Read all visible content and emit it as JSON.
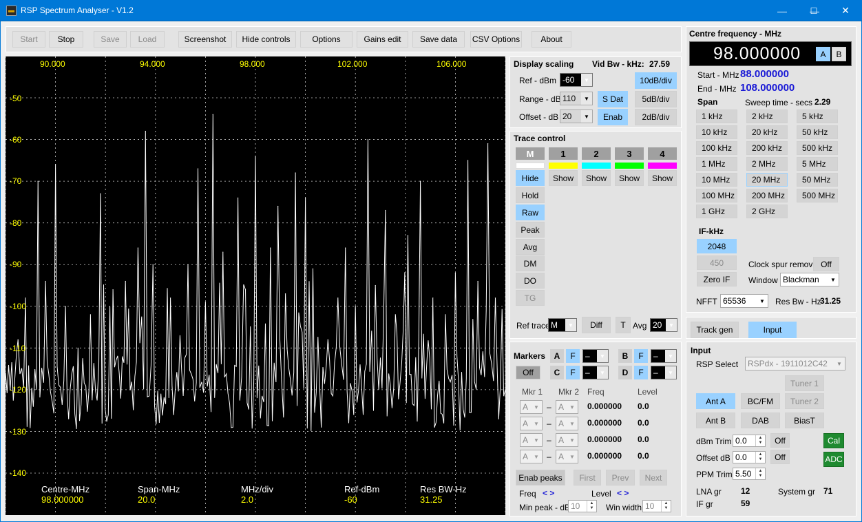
{
  "window": {
    "title": "RSP Spectrum Analyser - V1.2",
    "min": "—",
    "max": "☐",
    "close": "✕"
  },
  "toolbar": {
    "start": "Start",
    "stop": "Stop",
    "save": "Save",
    "load": "Load",
    "screenshot": "Screenshot",
    "hide_controls": "Hide controls",
    "options": "Options",
    "gains_edit": "Gains edit",
    "save_data": "Save data",
    "csv_options": "CSV Options",
    "about": "About"
  },
  "plot": {
    "x_ticks": [
      "90.000",
      "94.000",
      "98.000",
      "102.000",
      "106.000"
    ],
    "y_ticks": [
      "-50",
      "-60",
      "-70",
      "-80",
      "-90",
      "-100",
      "-110",
      "-120",
      "-130",
      "-140"
    ],
    "footer": {
      "centre_label": "Centre-MHz",
      "centre_value": "98.000000",
      "span_label": "Span-MHz",
      "span_value": "20.0",
      "mhzdiv_label": "MHz/div",
      "mhzdiv_value": "2.0",
      "ref_label": "Ref-dBm",
      "ref_value": "-60",
      "resbw_label": "Res BW-Hz",
      "resbw_value": "31.25"
    },
    "colors": {
      "bg": "#000000",
      "tick": "#ffff00",
      "trace": "#ffffff",
      "grid": "#cccccc"
    }
  },
  "chart_data": {
    "type": "line",
    "xlabel": "",
    "ylabel": "",
    "xlim": [
      88,
      108
    ],
    "ylim": [
      -145,
      -45
    ],
    "x_ticks": [
      90,
      94,
      98,
      102,
      106
    ],
    "y_ticks": [
      -50,
      -60,
      -70,
      -80,
      -90,
      -100,
      -110,
      -120,
      -130,
      -140
    ],
    "grid": true,
    "series": [
      {
        "values_note": "",
        "x": [
          88.0,
          88.5,
          88.8,
          89.3,
          89.6,
          90.0,
          90.4,
          90.9,
          91.4,
          91.8,
          92.3,
          92.8,
          93.3,
          93.6,
          93.9,
          94.6,
          95.3,
          95.7,
          96.0,
          96.3,
          96.7,
          97.3,
          97.6,
          98.0,
          98.6,
          98.9,
          99.2,
          99.6,
          100.0,
          100.3,
          100.9,
          101.3,
          101.6,
          102.0,
          102.5,
          102.8,
          103.2,
          103.6,
          104.1,
          104.6,
          105.1,
          105.6,
          106.0,
          106.5,
          106.9,
          107.3,
          107.6,
          108.0
        ],
        "y": [
          -116,
          -108,
          -98,
          -70,
          -94,
          -66,
          -100,
          -110,
          -102,
          -73,
          -96,
          -94,
          -86,
          -58,
          -90,
          -98,
          -90,
          -67,
          -99,
          -54,
          -87,
          -74,
          -96,
          -64,
          -86,
          -76,
          -97,
          -68,
          -74,
          -91,
          -108,
          -98,
          -86,
          -100,
          -60,
          -95,
          -77,
          -102,
          -83,
          -70,
          -98,
          -102,
          -92,
          -65,
          -94,
          -61,
          -98,
          -120
        ],
        "name": ""
      }
    ]
  },
  "display_scaling": {
    "title": "Display scaling",
    "vidbw_label": "Vid Bw - kHz:",
    "vidbw_value": "27.59",
    "ref_label": "Ref - dBm",
    "ref_value": "-60",
    "range_label": "Range - dB",
    "range_value": "110",
    "offset_label": "Offset - dB",
    "offset_value": "20",
    "sdat": "S Dat",
    "enab": "Enab",
    "div10": "10dB/div",
    "div5": "5dB/div",
    "div2": "2dB/div"
  },
  "trace_control": {
    "title": "Trace control",
    "heads": [
      "M",
      "1",
      "2",
      "3",
      "4"
    ],
    "colors": [
      "#ffffff",
      "#ffff00",
      "#00ffff",
      "#00ff00",
      "#ff00ff"
    ],
    "hide": "Hide",
    "show": "Show",
    "hold": "Hold",
    "raw": "Raw",
    "peak": "Peak",
    "avg": "Avg",
    "dm": "DM",
    "do": "DO",
    "tg": "TG",
    "ref_trace_label": "Ref trace",
    "ref_trace_value": "M",
    "diff": "Diff",
    "t": "T",
    "avg_label": "Avg",
    "avg_value": "20"
  },
  "markers": {
    "title": "Markers",
    "off": "Off",
    "a": "A",
    "b": "B",
    "c": "C",
    "d": "D",
    "f": "F",
    "dash": "–",
    "mkr1": "Mkr 1",
    "mkr2": "Mkr 2",
    "freq": "Freq",
    "level": "Level",
    "rows": [
      {
        "m1": "A",
        "m2": "A",
        "freq": "0.000000",
        "level": "0.0"
      },
      {
        "m1": "A",
        "m2": "A",
        "freq": "0.000000",
        "level": "0.0"
      },
      {
        "m1": "A",
        "m2": "A",
        "freq": "0.000000",
        "level": "0.0"
      },
      {
        "m1": "A",
        "m2": "A",
        "freq": "0.000000",
        "level": "0.0"
      }
    ],
    "enab_peaks": "Enab peaks",
    "first": "First",
    "prev": "Prev",
    "next": "Next",
    "freq_nav": "Freq",
    "level_nav": "Level",
    "nav_arrows": "< >",
    "min_peak_label": "Min peak - dB",
    "min_peak_value": "10",
    "win_width_label": "Win width",
    "win_width_value": "10"
  },
  "centre": {
    "title": "Centre frequency - MHz",
    "value": "98.000000",
    "a": "A",
    "b": "B",
    "start_label": "Start - MHz",
    "start_value": "88.000000",
    "end_label": "End - MHz",
    "end_value": "108.000000",
    "span_label": "Span",
    "sweep_label": "Sweep time - secs",
    "sweep_value": "2.29",
    "spans": [
      "1 kHz",
      "2 kHz",
      "5 kHz",
      "10 kHz",
      "20 kHz",
      "50 kHz",
      "100 kHz",
      "200 kHz",
      "500 kHz",
      "1 MHz",
      "2 MHz",
      "5 MHz",
      "10 MHz",
      "20 MHz",
      "50 MHz",
      "100 MHz",
      "200 MHz",
      "500 MHz",
      "1 GHz",
      "2 GHz"
    ],
    "if_label": "IF-kHz",
    "if_2048": "2048",
    "if_450": "450",
    "zero_if": "Zero IF",
    "clock_spur_label": "Clock spur removal",
    "clock_spur_value": "Off",
    "window_label": "Window",
    "window_value": "Blackman",
    "nfft_label": "NFFT",
    "nfft_value": "65536",
    "resbw_label": "Res Bw - Hz",
    "resbw_value": "31.25"
  },
  "modes": {
    "track_gen": "Track gen",
    "input": "Input"
  },
  "input": {
    "title": "Input",
    "rsp_label": "RSP Select",
    "rsp_value": "RSPdx - 1911012C42",
    "tuner1": "Tuner 1",
    "tuner2": "Tuner 2",
    "ant_a": "Ant A",
    "bcfm": "BC/FM",
    "ant_b": "Ant B",
    "dab": "DAB",
    "biast": "BiasT",
    "dbm_trim_label": "dBm Trim",
    "dbm_trim_value": "0.0",
    "offset_label": "Offset dB",
    "offset_value": "0.0",
    "off": "Off",
    "cal": "Cal",
    "adc": "ADC",
    "ppm_label": "PPM Trim",
    "ppm_value": "5.50",
    "lna_label": "LNA gr",
    "lna_value": "12",
    "system_label": "System gr",
    "system_value": "71",
    "if_gr_label": "IF gr",
    "if_gr_value": "59"
  }
}
